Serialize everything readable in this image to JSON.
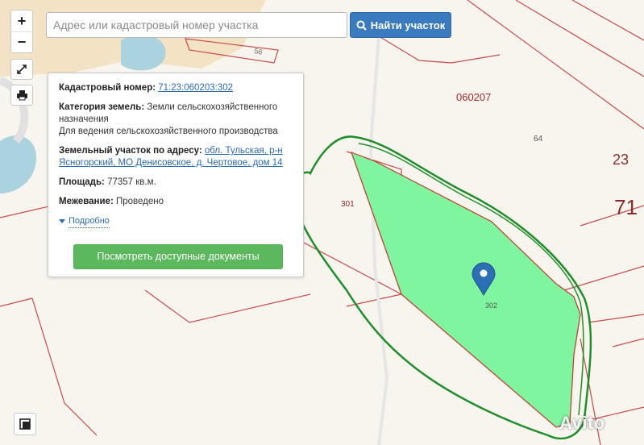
{
  "search": {
    "placeholder": "Адрес или кадастровый номер участка",
    "button_label": "Найти участок"
  },
  "controls": {
    "zoom_in_label": "+",
    "zoom_out_label": "−"
  },
  "popup": {
    "cadastral_label": "Кадастровый номер:",
    "cadastral_value": "71:23:060203:302",
    "category_label": "Категория земель:",
    "category_value": "Земли сельскохозяйственного назначения",
    "category_usage": "Для ведения сельскохозяйственного производства",
    "address_label": "Земельный участок по адресу:",
    "address_value": "обл. Тульская, р-н Ясногорский, МО Денисовское, д. Чертовое, дом 14",
    "area_label": "Площадь:",
    "area_value": "77357 кв.м.",
    "survey_label": "Межевание:",
    "survey_value": "Проведено",
    "more_label": "Подробно",
    "docs_button": "Посмотреть доступные документы"
  },
  "map": {
    "labels": {
      "road": "56",
      "block": "060207",
      "parcel_64": "64",
      "num_23": "23",
      "num_71": "71",
      "parcel_301": "301",
      "parcel_302": "302"
    },
    "colors": {
      "parcel_fill": "#7ff5a0",
      "parcel_border": "#c0392b",
      "boundary": "#c74a4a",
      "hand_outline": "#1f8f2a",
      "water": "#aad3df",
      "accent_button": "#3a7bbf",
      "docs_button": "#5cb85c"
    }
  },
  "watermark": "Avito"
}
